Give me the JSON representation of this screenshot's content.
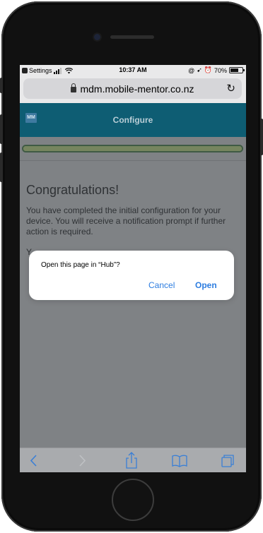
{
  "status_bar": {
    "carrier": "Settings",
    "time": "10:37 AM",
    "battery_label": "70%",
    "battery_level": 0.7
  },
  "address_bar": {
    "url": "mdm.mobile-mentor.co.nz"
  },
  "app_header": {
    "logo_text": "MM",
    "title": "Configure"
  },
  "progress": {
    "value": 1.0
  },
  "page": {
    "heading": "Congratulations!",
    "body": "You have completed the initial configuration for your device. You will receive a notification prompt if further action is required.",
    "body2": "Y"
  },
  "dialog": {
    "message": "Open this page in “Hub”?",
    "cancel_label": "Cancel",
    "open_label": "Open"
  },
  "toolbar": {
    "icons": [
      "back-icon",
      "forward-icon",
      "share-icon",
      "bookmarks-icon",
      "tabs-icon"
    ]
  }
}
